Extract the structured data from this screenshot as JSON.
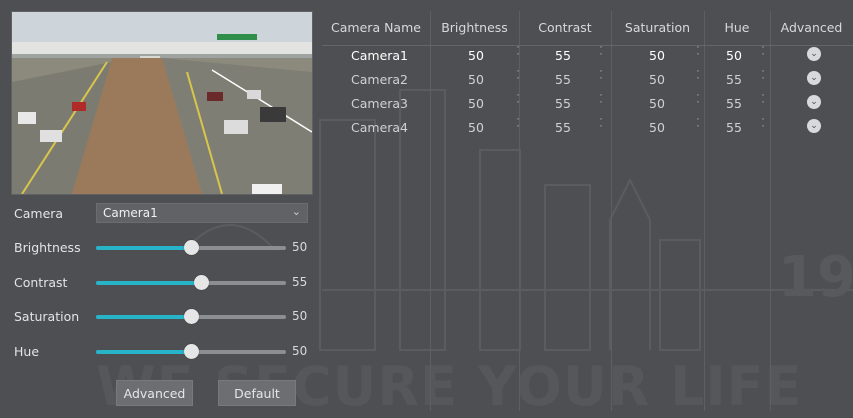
{
  "left_panel": {
    "camera_label": "Camera",
    "camera_select_value": "Camera1",
    "sliders": [
      {
        "label": "Brightness",
        "value": "50",
        "level": 0.5
      },
      {
        "label": "Contrast",
        "value": "55",
        "level": 0.55
      },
      {
        "label": "Saturation",
        "value": "50",
        "level": 0.5
      },
      {
        "label": "Hue",
        "value": "50",
        "level": 0.5
      }
    ],
    "advanced_button": "Advanced",
    "default_button": "Default"
  },
  "table": {
    "headers": [
      "Camera Name",
      "Brightness",
      "Contrast",
      "Saturation",
      "Hue",
      "Advanced"
    ],
    "rows": [
      {
        "name": "Camera1",
        "brightness": "50",
        "contrast": "55",
        "saturation": "50",
        "hue": "50"
      },
      {
        "name": "Camera2",
        "brightness": "50",
        "contrast": "55",
        "saturation": "50",
        "hue": "55"
      },
      {
        "name": "Camera3",
        "brightness": "50",
        "contrast": "55",
        "saturation": "50",
        "hue": "55"
      },
      {
        "name": "Camera4",
        "brightness": "50",
        "contrast": "55",
        "saturation": "50",
        "hue": "55"
      }
    ],
    "selected_row": 0
  },
  "background_watermark": "WE SECURE YOUR LIFE",
  "background_year": "19",
  "icons": {
    "dropdown": "chevron-down-icon",
    "spinner": "spinner-up-down-icon",
    "advanced": "chevron-circle-icon"
  },
  "colors": {
    "accent": "#27b3c8",
    "background": "#4d4f52"
  }
}
